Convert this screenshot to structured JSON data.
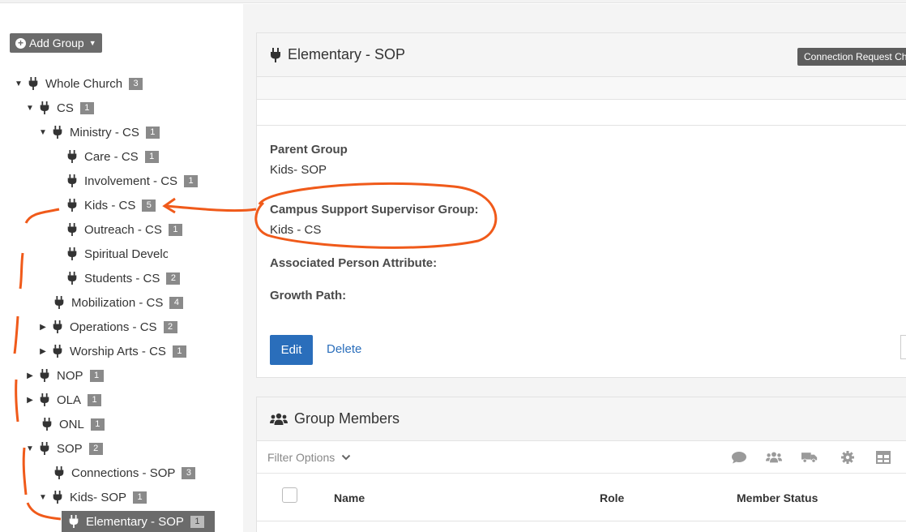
{
  "add_group": {
    "label": "Add Group"
  },
  "tree": [
    {
      "name": "Whole Church",
      "count": "3",
      "expanded": true
    },
    {
      "name": "CS",
      "count": "1",
      "expanded": true
    },
    {
      "name": "Ministry - CS",
      "count": "1",
      "expanded": true
    },
    {
      "name": "Care - CS",
      "count": "1"
    },
    {
      "name": "Involvement - CS",
      "count": "1"
    },
    {
      "name": "Kids - CS",
      "count": "5"
    },
    {
      "name": "Outreach - CS",
      "count": "1"
    },
    {
      "name": "Spiritual Development - C",
      "count": ""
    },
    {
      "name": "Students - CS",
      "count": "2"
    },
    {
      "name": "Mobilization - CS",
      "count": "4"
    },
    {
      "name": "Operations - CS",
      "count": "2",
      "expanded": false
    },
    {
      "name": "Worship Arts - CS",
      "count": "1",
      "expanded": false
    },
    {
      "name": "NOP",
      "count": "1",
      "expanded": false
    },
    {
      "name": "OLA",
      "count": "1",
      "expanded": false
    },
    {
      "name": "ONL",
      "count": "1"
    },
    {
      "name": "SOP",
      "count": "2",
      "expanded": true
    },
    {
      "name": "Connections - SOP",
      "count": "3"
    },
    {
      "name": "Kids- SOP",
      "count": "1",
      "expanded": true
    },
    {
      "name": "Elementary - SOP",
      "count": "1",
      "selected": true
    }
  ],
  "detail": {
    "title": "Elementary - SOP",
    "tag": "Connection Request Cha",
    "parent_label": "Parent Group",
    "parent_value": "Kids- SOP",
    "campus_label": "Campus Support Supervisor Group:",
    "campus_value": "Kids - CS",
    "assoc_label": "Associated Person Attribute:",
    "growth_label": "Growth Path:",
    "edit_label": "Edit",
    "delete_label": "Delete"
  },
  "members": {
    "title": "Group Members",
    "filter_label": "Filter Options",
    "columns": [
      "Name",
      "Role",
      "Member Status"
    ]
  },
  "colors": {
    "accent": "#2a6ebb",
    "annotation": "#f05a1a",
    "badge": "#8a8a8a",
    "selected_row": "#6b6b6b"
  },
  "icons": [
    "plug-icon",
    "plus-circle-icon",
    "users-icon",
    "comment-icon",
    "truck-icon",
    "gear-icon",
    "table-icon",
    "chevron-down-icon"
  ]
}
